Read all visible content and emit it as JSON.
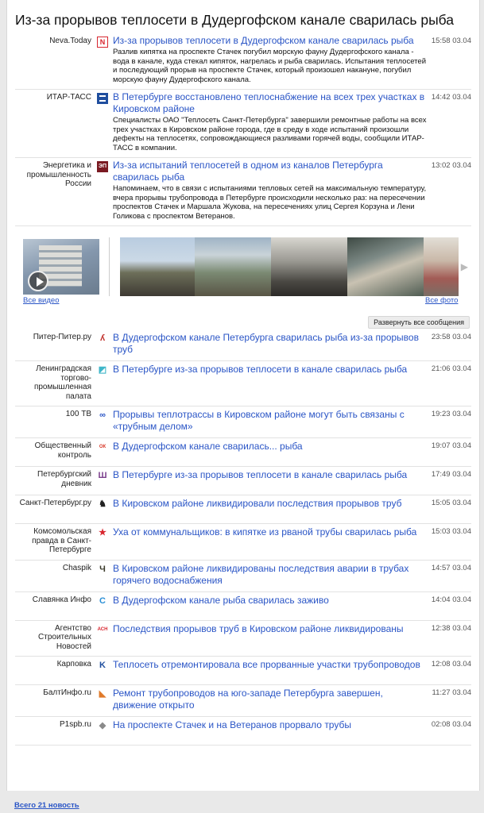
{
  "headline": "Из-за прорывов теплосети в Дудергофском канале сварилась рыба",
  "top_items": [
    {
      "source": "Neva.Today",
      "icon": "neva-today-logo-icon",
      "icon_color": "#d8262f",
      "title": "Из-за прорывов теплосети в Дудергофском канале сварилась рыба",
      "snippet": "Разлив кипятка на проспекте Стачек погубил морскую фауну Дудергофского канала - вода в канале, куда стекал кипяток, нагрелась и рыба сварилась. Испытания теплосетей и последующий прорыв на проспекте Стачек, который произошел накануне, погубил морскую фауну Дудергофского канала.",
      "time": "15:58 03.04"
    },
    {
      "source": "ИТАР-ТАСС",
      "icon": "itar-tass-logo-icon",
      "icon_color": "#1f4e9e",
      "title": "В Петербурге восстановлено теплоснабжение на всех трех участках в Кировском районе",
      "snippet": "Специалисты ОАО \"Теплосеть Санкт-Петербурга\" завершили ремонтные работы на всех трех участках в Кировском районе города, где в среду в ходе испытаний произошли дефекты на теплосетях, сопровождающиеся разливами горячей воды, сообщили ИТАР-ТАСС в компании.",
      "time": "14:42 03.04"
    },
    {
      "source": "Энергетика и промышленность России",
      "icon": "energetika-logo-icon",
      "icon_color": "#7a1a22",
      "title": "Из-за испытаний теплосетей в одном из каналов Петербурга сварилась рыба",
      "snippet": "Напоминаем, что в связи с испытаниями тепловых сетей на максимальную температуру, вчера прорывы трубопровода в Петербурге происходили несколько раз: на пересечении проспектов Стачек и Маршала Жукова, на пересечениях улиц Сергея Корзуна и Лени Голикова с проспектом Ветеранов.",
      "time": "13:02 03.04"
    }
  ],
  "media": {
    "all_video": "Все видео",
    "all_photo": "Все фото"
  },
  "expand_label": "Развернуть все сообщения",
  "list_items": [
    {
      "source": "Питер-Питер.ру",
      "icon": "piter-piter-logo-icon",
      "icon_color": "#c0302a",
      "title": "В Дудергофском канале Петербурга сварилась рыба из-за прорывов труб",
      "time": "23:58 03.04"
    },
    {
      "source": "Ленинградская торгово-промышленная палата",
      "icon": "ltpp-logo-icon",
      "icon_color": "#3fb6c9",
      "title": "В Петербурге из-за прорывов теплосети в канале сварилась рыба",
      "time": "21:06 03.04"
    },
    {
      "source": "100 ТВ",
      "icon": "100tv-logo-icon",
      "icon_color": "#2a55c6",
      "title": "Прорывы теплотрассы в Кировском районе могут быть связаны с «трубным делом»",
      "time": "19:23 03.04"
    },
    {
      "source": "Общественный контроль",
      "icon": "obshchestvenny-kontrol-logo-icon",
      "icon_color": "#d83a2a",
      "title": "В Дудергофском канале сварилась... рыба",
      "time": "19:07 03.04"
    },
    {
      "source": "Петербургский дневник",
      "icon": "peterburgsky-dnevnik-logo-icon",
      "icon_color": "#7b3f8c",
      "title": "В Петербурге из-за прорывов теплосети в канале сварилась рыба",
      "time": "17:49 03.04"
    },
    {
      "source": "Санкт-Петербург.ру",
      "icon": "spb-ru-logo-icon",
      "icon_color": "#222222",
      "title": "В Кировском районе ликвидировали последствия прорывов труб",
      "time": "15:05 03.04"
    },
    {
      "source": "Комсомольская правда в Санкт-Петербурге",
      "icon": "kp-logo-icon",
      "icon_color": "#d8262f",
      "title": "Уха от коммунальщиков: в кипятке из рваной трубы сварилась рыба",
      "time": "15:03 03.04"
    },
    {
      "source": "Chaspik",
      "icon": "chaspik-logo-icon",
      "icon_color": "#3a3a2a",
      "title": "В Кировском районе ликвидированы последствия аварии в трубах горячего водоснабжения",
      "time": "14:57 03.04"
    },
    {
      "source": "Славянка Инфо",
      "icon": "slavyanka-logo-icon",
      "icon_color": "#2a8fd6",
      "title": "В Дудергофском канале рыба сварилась заживо",
      "time": "14:04 03.04"
    },
    {
      "source": "Агентство Строительных Новостей",
      "icon": "asn-logo-icon",
      "icon_color": "#d8262f",
      "title": "Последствия прорывов труб в Кировском районе ликвидированы",
      "time": "12:38 03.04"
    },
    {
      "source": "Карповка",
      "icon": "karpovka-logo-icon",
      "icon_color": "#1f4e9e",
      "title": "Теплосеть отремонтировала все прорванные участки трубопроводов",
      "time": "12:08 03.04"
    },
    {
      "source": "БалтИнфо.ru",
      "icon": "baltinfo-logo-icon",
      "icon_color": "#e07a2a",
      "title": "Ремонт трубопроводов на юго-западе Петербурга завершен, движение открыто",
      "time": "11:27 03.04"
    },
    {
      "source": "P1spb.ru",
      "icon": "p1spb-logo-icon",
      "icon_color": "#8a8a8a",
      "title": "На проспекте Стачек и на Ветеранов прорвало трубы",
      "time": "02:08 03.04"
    }
  ],
  "footer": "Всего 21 новость"
}
